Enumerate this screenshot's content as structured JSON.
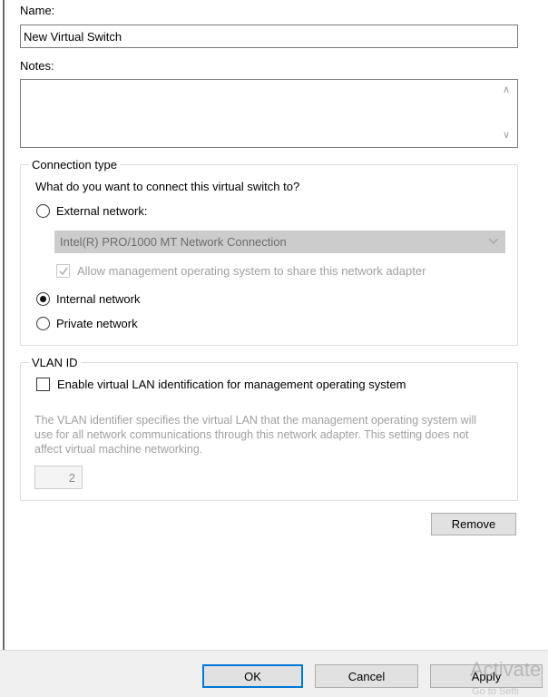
{
  "name": {
    "label": "Name:",
    "value": "New Virtual Switch"
  },
  "notes": {
    "label": "Notes:",
    "value": ""
  },
  "connection_type": {
    "legend": "Connection type",
    "question": "What do you want to connect this virtual switch to?",
    "external_label": "External network:",
    "adapter_selected": "Intel(R) PRO/1000 MT Network Connection",
    "allow_mgmt_label": "Allow management operating system to share this network adapter",
    "internal_label": "Internal network",
    "private_label": "Private network",
    "selected": "internal"
  },
  "vlan": {
    "legend": "VLAN ID",
    "enable_label": "Enable virtual LAN identification for management operating system",
    "description": "The VLAN identifier specifies the virtual LAN that the management operating system will use for all network communications through this network adapter. This setting does not affect virtual machine networking.",
    "value": "2"
  },
  "buttons": {
    "remove": "Remove",
    "ok": "OK",
    "cancel": "Cancel",
    "apply": "Apply"
  },
  "watermark": {
    "text": "Activate",
    "sub": "Go to Setti"
  },
  "colors": {
    "focus_border": "#0078d7",
    "disabled_text": "#a0a0a0",
    "combo_bg": "#cccccc"
  }
}
